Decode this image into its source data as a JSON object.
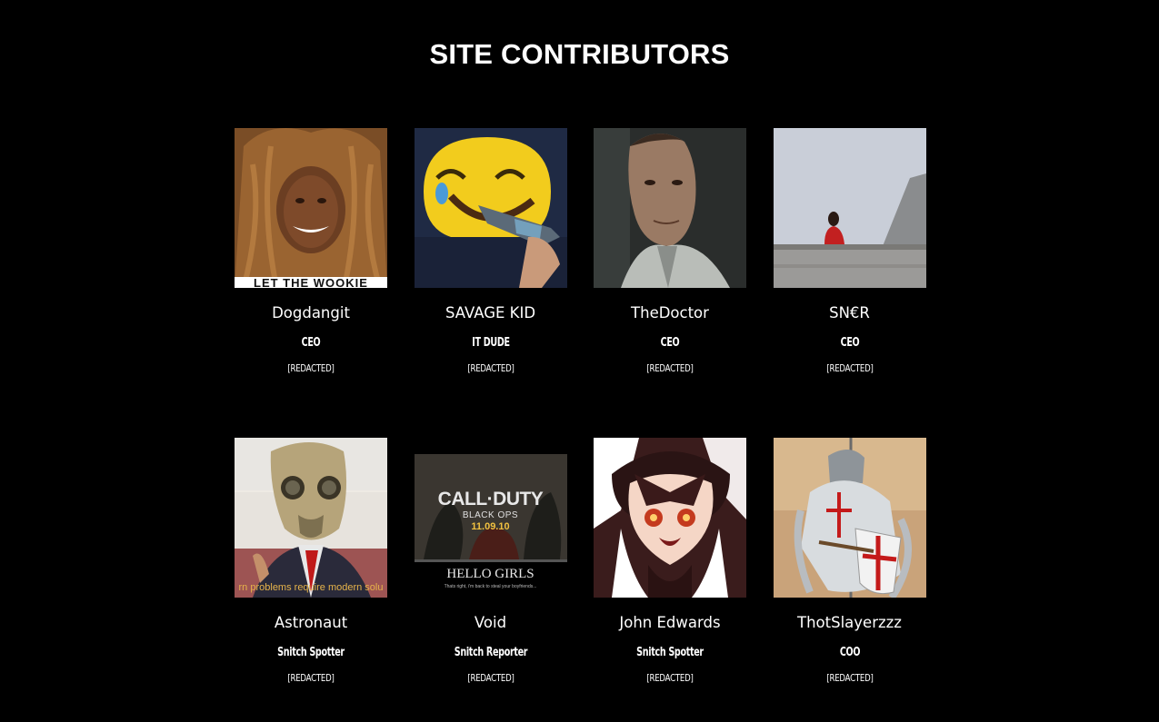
{
  "page": {
    "title": "SITE CONTRIBUTORS"
  },
  "colors": {
    "background": "#000000",
    "text": "#ffffff"
  },
  "contributors": [
    {
      "name": "Dogdangit",
      "role": "CEO",
      "status": "[REDACTED]",
      "avatar_caption": "LET THE WOOKIE"
    },
    {
      "name": "SAVAGE KID",
      "role": "IT DUDE",
      "status": "[REDACTED]"
    },
    {
      "name": "TheDoctor",
      "role": "CEO",
      "status": "[REDACTED]"
    },
    {
      "name": "SN€R",
      "role": "CEO",
      "status": "[REDACTED]"
    },
    {
      "name": "Astronaut",
      "role": "Snitch Spotter",
      "status": "[REDACTED]",
      "avatar_caption": "rn problems require modern solu"
    },
    {
      "name": "Void",
      "role": "Snitch Reporter",
      "status": "[REDACTED]",
      "avatar_caption": "CALL·DUTY",
      "avatar_subcaption": "BLACK OPS",
      "avatar_date": "11.09.10",
      "avatar_tagline": "HELLO GIRLS",
      "avatar_fineprint": "Thats right, i'm back to steal your boyfriends..."
    },
    {
      "name": "John Edwards",
      "role": "Snitch Spotter",
      "status": "[REDACTED]"
    },
    {
      "name": "ThotSlayerzzz",
      "role": "COO",
      "status": "[REDACTED]"
    }
  ]
}
